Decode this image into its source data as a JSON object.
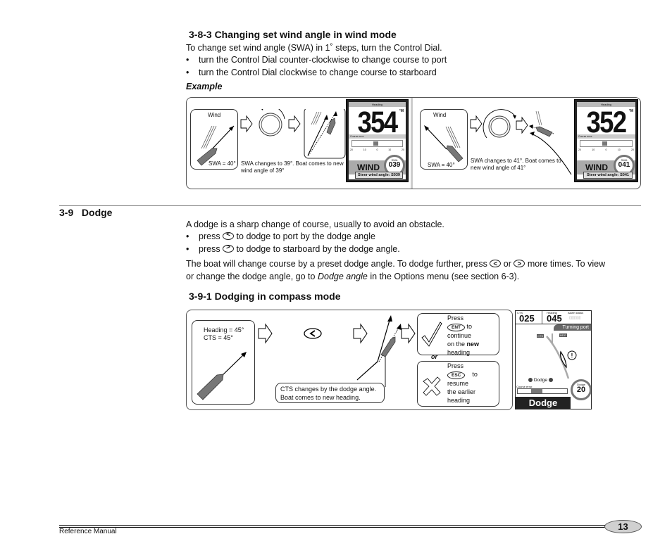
{
  "section_383": {
    "heading": "3-8-3 Changing set wind angle in wind mode",
    "intro": "To change set wind angle (SWA) in 1˚ steps, turn the Control Dial.",
    "bullets": [
      "turn the Control Dial counter-clockwise to change course to port",
      "turn the Control Dial clockwise to change course to starboard"
    ],
    "example_label": "Example",
    "diagram_port": {
      "wind_label": "Wind",
      "swa_label": "SWA = 40°",
      "caption": "SWA changes to 39°. Boat comes to new wind angle of 39°",
      "caption_line1": "SWA changes to 39°. Boat comes to new",
      "caption_line2": "wind angle of 39°",
      "display": {
        "header": "Heading",
        "heading_value": "354",
        "unit": "°M",
        "course_error_label": "Course error",
        "scale_ticks": [
          "20",
          "10",
          "0",
          "10",
          "20"
        ],
        "mode": "WIND",
        "swa_label": "SWA",
        "swa_value": "039",
        "swa_unit": "°s",
        "footer": "Steer wind angle: S039",
        "course_error_fraction": 0.45
      }
    },
    "diagram_starboard": {
      "wind_label": "Wind",
      "swa_label": "SWA = 40°",
      "caption_line1": "SWA changes to 41°. Boat comes to",
      "caption_line2": "new wind angle of 41°",
      "display": {
        "header": "Heading",
        "heading_value": "352",
        "unit": "°M",
        "course_error_label": "Course error",
        "scale_ticks": [
          "20",
          "10",
          "0",
          "10",
          "20"
        ],
        "mode": "WIND",
        "swa_label": "SWA",
        "swa_value": "041",
        "swa_unit": "°s",
        "footer": "Steer wind angle: S041",
        "course_error_fraction": 0.45
      }
    }
  },
  "section_39": {
    "number": "3-9",
    "title": "Dodge",
    "intro": "A dodge is a sharp change of course, usually to avoid an obstacle.",
    "bullet1_pre": "press",
    "bullet1_post": "to dodge to port by the dodge angle",
    "bullet2_pre": "press",
    "bullet2_post": "to dodge to starboard by the dodge angle.",
    "para_line1_a": "The boat will change course by a preset dodge angle. To dodge further, press",
    "para_line1_or": "or",
    "para_line1_b": "more times. To view",
    "para_line2_a": "or change the dodge angle, go to",
    "para_line2_italic": "Dodge angle",
    "para_line2_b": "in the Options menu (see section 6-3)."
  },
  "section_391": {
    "heading": "3-9-1 Dodging in compass mode",
    "heading_label": "Heading = 45°",
    "cts_label": "CTS = 45°",
    "caption_line1": "CTS changes by the dodge angle.",
    "caption_line2": "Boat comes to new heading.",
    "continue_box": {
      "press": "Press",
      "key": "ENT",
      "to": "to",
      "line3": "continue",
      "line4_pre": "on the",
      "line4_bold": "new",
      "line5": "heading"
    },
    "or_label": "or",
    "resume_box": {
      "press": "Press",
      "key": "ESC",
      "to": "to",
      "line3": "resume",
      "line4": "the earlier",
      "line5": "heading"
    },
    "display": {
      "cts_label": "CTS",
      "cts_value": "025",
      "heading_label": "Heading",
      "heading_value": "045",
      "alarm_label": "Alarm status",
      "status": "Turning port",
      "tag_left": "CTS",
      "tag_right": "HDG",
      "dodge_label": "Dodge",
      "course_error_label": "Course error",
      "dodge_angle_label": "Dodge",
      "dodge_angle_value": "20",
      "dodge_angle_unit": "°",
      "mode": "Dodge"
    }
  },
  "footer": {
    "left": "Reference Manual",
    "page_number": "13"
  }
}
